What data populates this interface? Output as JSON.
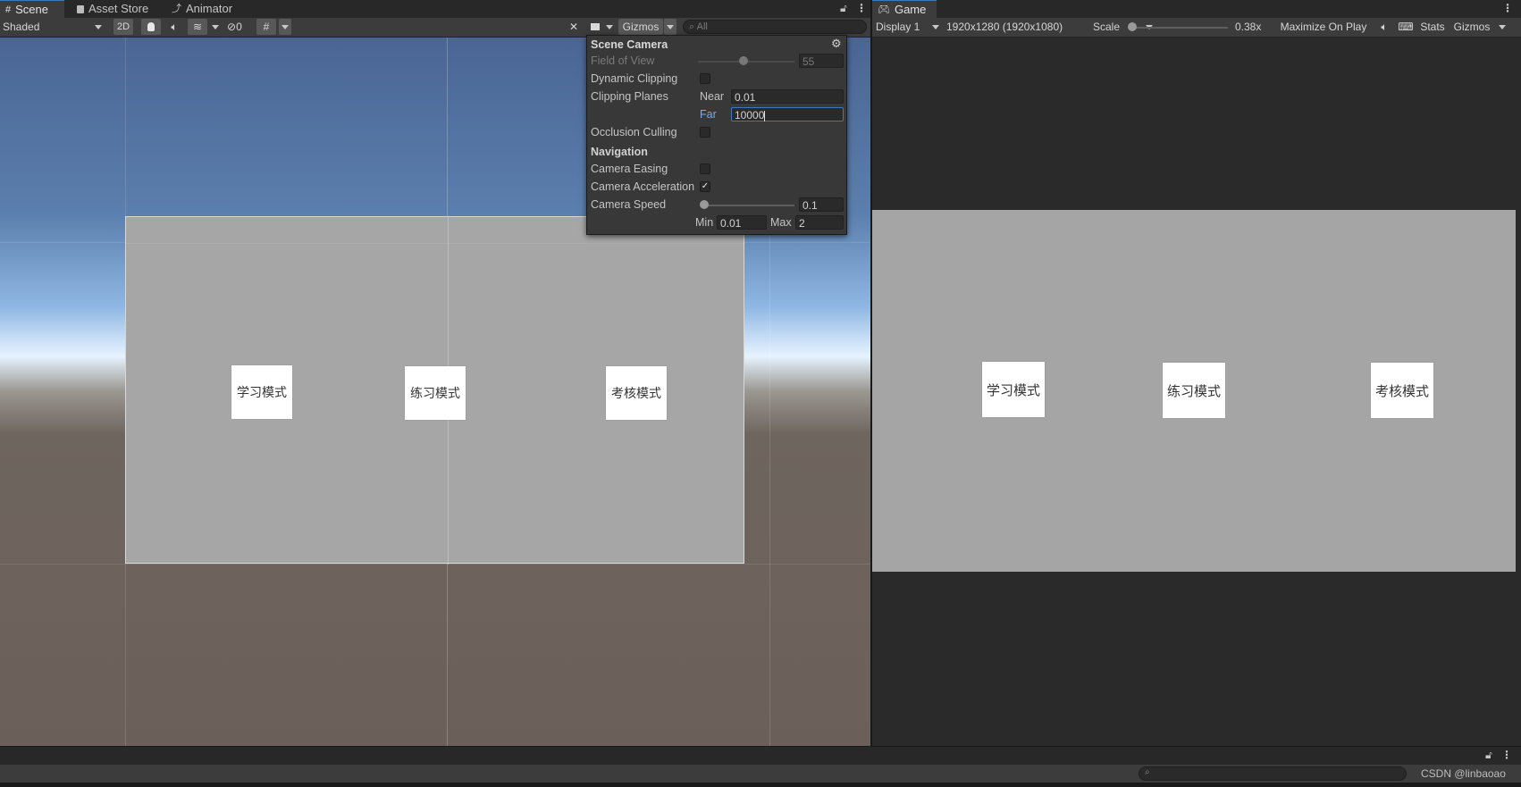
{
  "scene_window": {
    "tabs": [
      {
        "label": "Scene",
        "icon": "grid-icon"
      },
      {
        "label": "Asset Store",
        "icon": "bag-icon"
      },
      {
        "label": "Animator",
        "icon": "animator-icon"
      }
    ],
    "toolbar": {
      "draw_mode": "Shaded",
      "mode_2d": "2D",
      "hidden_count": "0",
      "gizmos_label": "Gizmos",
      "search_placeholder": "All"
    },
    "ui_buttons": [
      "学习模式",
      "练习模式",
      "考核模式"
    ]
  },
  "scene_camera_popup": {
    "title": "Scene Camera",
    "field_of_view_label": "Field of View",
    "field_of_view_value": "55",
    "dynamic_clipping_label": "Dynamic Clipping",
    "dynamic_clipping_checked": false,
    "clipping_planes_label": "Clipping Planes",
    "near_label": "Near",
    "near_value": "0.01",
    "far_label": "Far",
    "far_value": "10000",
    "occlusion_culling_label": "Occlusion Culling",
    "occlusion_culling_checked": false,
    "navigation_label": "Navigation",
    "camera_easing_label": "Camera Easing",
    "camera_easing_checked": false,
    "camera_acceleration_label": "Camera Acceleration",
    "camera_acceleration_checked": true,
    "camera_speed_label": "Camera Speed",
    "camera_speed_value": "0.1",
    "min_label": "Min",
    "min_value": "0.01",
    "max_label": "Max",
    "max_value": "2"
  },
  "game_window": {
    "tab_label": "Game",
    "display": "Display 1",
    "resolution": "1920x1280 (1920x1080)",
    "scale_label": "Scale",
    "scale_value": "0.38x",
    "maximize_label": "Maximize On Play",
    "stats_label": "Stats",
    "gizmos_label": "Gizmos",
    "ui_buttons": [
      "学习模式",
      "练习模式",
      "考核模式"
    ]
  },
  "watermark": "CSDN @linbaoao",
  "colors": {
    "accent_blue": "#3a79bb",
    "panel_bg": "#3c3c3c",
    "tab_bar_bg": "#282828",
    "canvas_gray": "#a6a6a6"
  }
}
